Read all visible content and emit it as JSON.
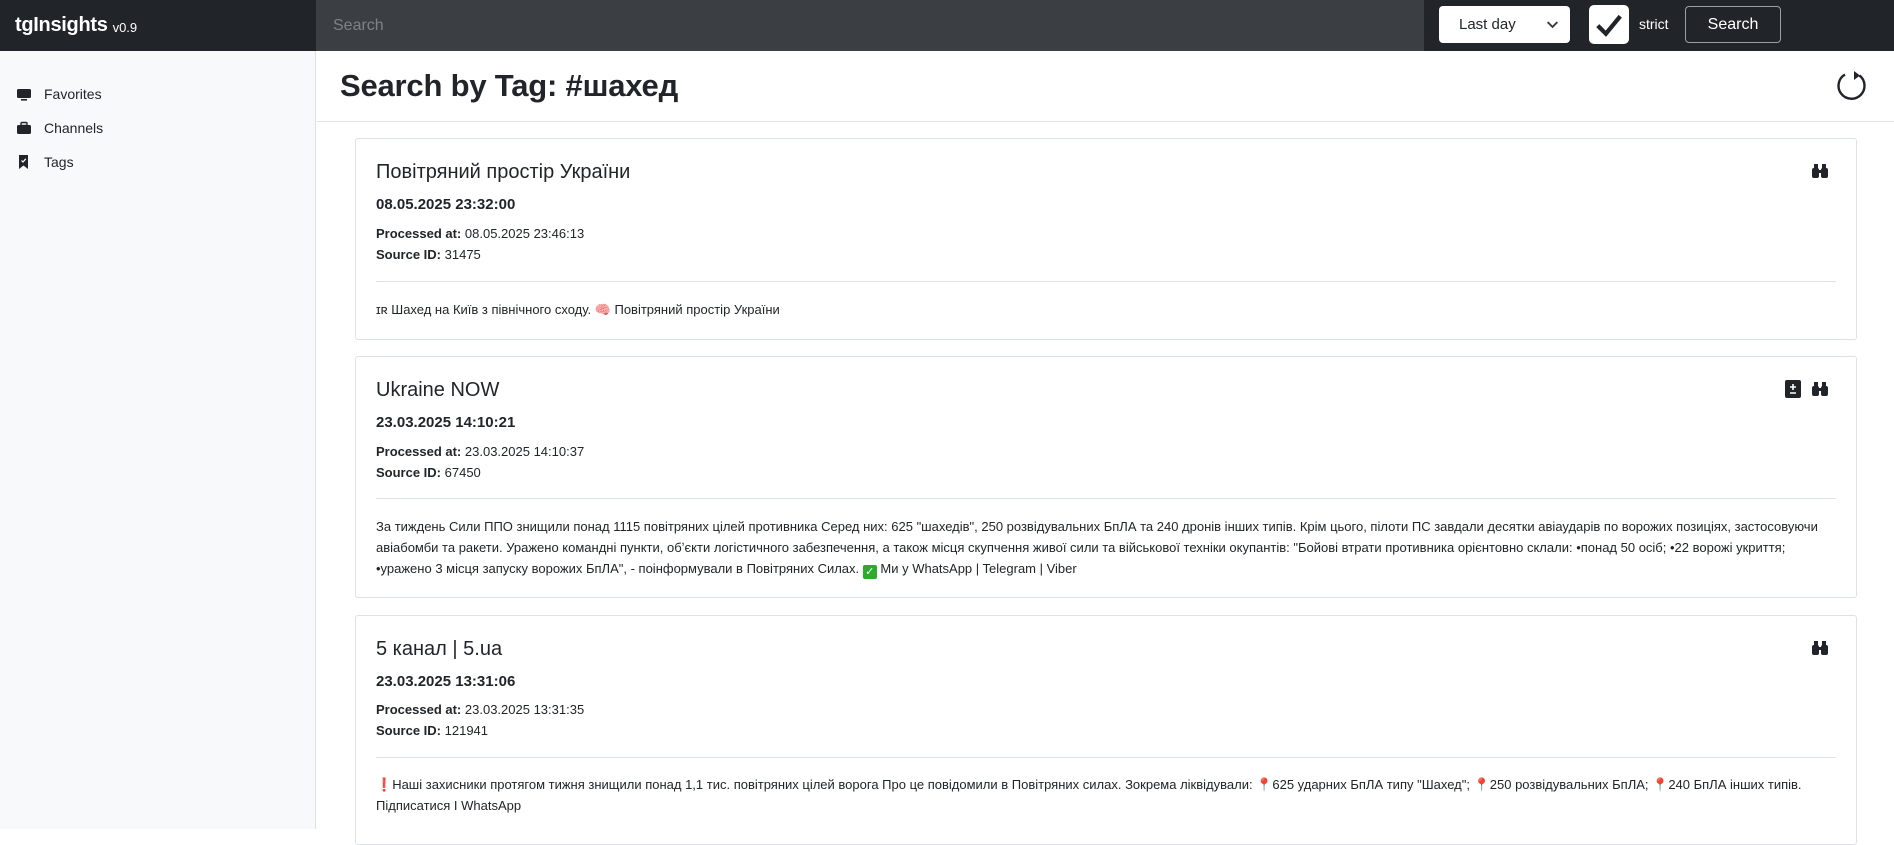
{
  "app": {
    "name": "tgInsights",
    "version": "v0.9"
  },
  "topbar": {
    "search_placeholder": "Search",
    "period": "Last day",
    "strict_label": "strict",
    "search_button": "Search"
  },
  "sidebar": {
    "items": [
      {
        "label": "Favorites",
        "icon": "monitor-icon"
      },
      {
        "label": "Channels",
        "icon": "briefcase-icon"
      },
      {
        "label": "Tags",
        "icon": "bookmark-icon"
      }
    ]
  },
  "page": {
    "title": "Search by Tag: #шахед"
  },
  "labels": {
    "processed_at": "Processed at:",
    "source_id": "Source ID:"
  },
  "posts": [
    {
      "channel": "Повітряний простір України",
      "date": "08.05.2025 23:32:00",
      "processed_at": "08.05.2025 23:46:13",
      "source_id": "31475",
      "text_parts": [
        "ɪʀ Шахед на Київ з північного сходу. ",
        "🧠",
        " Повітряний простір України"
      ]
    },
    {
      "channel": "Ukraine NOW",
      "date": "23.03.2025 14:10:21",
      "processed_at": "23.03.2025 14:10:37",
      "source_id": "67450",
      "text_parts": [
        "За тиждень Сили ППО знищили понад 1115 повітряних цілей противника Серед них: 625 \"шахедів\", 250 розвідувальних БпЛА та 240 дронів інших типів. Крім цього, пілоти ПС завдали десятки авіаударів по ворожих позиціях, застосовуючи авіабомби та ракети. Уражено командні пункти, обʼєкти логістичного забезпечення, а також місця скупчення живої сили та військової техніки окупантів: \"Бойові втрати противника орієнтовно склали: •понад 50 осіб; •22 ворожі укриття; •уражено 3 місця запуску ворожих БпЛА\", - поінформували в Повітряних Силах. ",
        "✓",
        " Ми у WhatsApp | Telegram | Viber"
      ]
    },
    {
      "channel": "5 канал | 5.ua",
      "date": "23.03.2025 13:31:06",
      "processed_at": "23.03.2025 13:31:35",
      "source_id": "121941",
      "text_parts": [
        "❗",
        "Наші захисники протягом тижня знищили понад 1,1 тис. повітряних цілей ворога Про це повідомили в Повітряних силах. Зокрема ліквідували: ",
        "📍",
        "625 ударних БпЛА типу \"Шахед\"; ",
        "📍",
        "250 розвідувальних БпЛА; ",
        "📍",
        "240 БпЛА інших типів. Підписатися І WhatsApp"
      ]
    }
  ]
}
